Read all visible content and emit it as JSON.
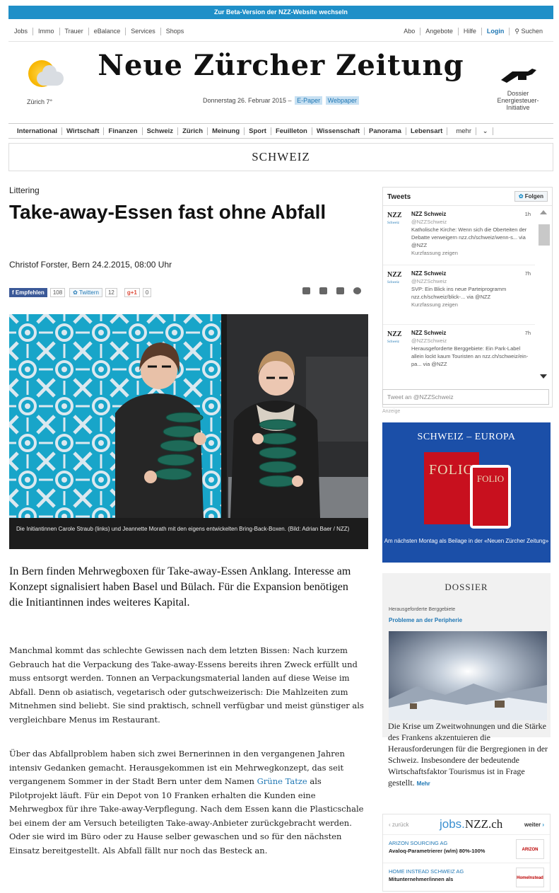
{
  "beta_banner": "Zur Beta-Version der NZZ-Website wechseln",
  "top_nav": {
    "left": [
      "Jobs",
      "Immo",
      "Trauer",
      "eBalance",
      "Services",
      "Shops"
    ],
    "right": [
      "Abo",
      "Angebote",
      "Hilfe",
      "Login",
      "Suchen"
    ]
  },
  "masthead": {
    "weather": "Zürich 7°",
    "logo": "Neue Zürcher Zeitung",
    "date": "Donnerstag 26. Februar 2015 –",
    "epaper": "E-Paper",
    "webpaper": "Webpaper",
    "dossier": "Dossier Energiesteuer-Initiative"
  },
  "section_nav": [
    "International",
    "Wirtschaft",
    "Finanzen",
    "Schweiz",
    "Zürich",
    "Meinung",
    "Sport",
    "Feuilleton",
    "Wissenschaft",
    "Panorama",
    "Lebensart",
    "mehr"
  ],
  "section_title": "SCHWEIZ",
  "article": {
    "kicker": "Littering",
    "headline": "Take-away-Essen fast ohne Abfall",
    "byline": "Christof Forster, Bern   24.2.2015, 08:00 Uhr",
    "social": {
      "fb_label": "Empfehlen",
      "fb_count": "108",
      "tw_label": "Twittern",
      "tw_count": "12",
      "gp_label": "g+1",
      "gp_count": "0"
    },
    "caption": "Die Initiantinnen Carole Straub (links) und Jeannette Morath mit den eigens entwickelten Bring-Back-Boxen.  (Bild: Adrian Baer / NZZ)",
    "lead": "In Bern finden Mehrwegboxen für Take-away-Essen Anklang. Interesse am Konzept signalisiert haben Basel und Bülach. Für die Expansion benötigen die Initiantinnen indes weiteres Kapital.",
    "p1": "Manchmal kommt das schlechte Gewissen nach dem letzten Bissen: Nach kurzem Gebrauch hat die Verpackung des Take-away-Essens bereits ihren Zweck erfüllt und muss entsorgt werden. Tonnen an Verpackungsmaterial landen auf diese Weise im Abfall. Denn ob asiatisch, vegetarisch oder gutschweizerisch: Die Mahlzeiten zum Mitnehmen sind beliebt. Sie sind praktisch, schnell verfügbar und meist günstiger als vergleichbare Menus im Restaurant.",
    "p2_before": "Über das Abfallproblem haben sich zwei Bernerinnen in den vergangenen Jahren intensiv Gedanken gemacht. Herausgekommen ist ein Mehrwegkonzept, das seit vergangenem Sommer in der Stadt Bern unter dem Namen ",
    "p2_link": "Grüne Tatze",
    "p2_after": " als Pilotprojekt läuft. Für ein Depot von 10 Franken erhalten die Kunden eine Mehrwegbox für ihre Take-away-Verpflegung. Nach dem Essen kann die Plasticschale bei einem der am Versuch beteiligten Take-away-Anbieter zurückgebracht werden. Oder sie wird im Büro oder zu Hause selber gewaschen und so für den nächsten Einsatz bereitgestellt. Als Abfall fällt nur noch das Besteck an."
  },
  "tweets": {
    "title": "Tweets",
    "follow": "Folgen",
    "items": [
      {
        "name": "NZZ Schweiz",
        "handle": "@NZZSchweiz",
        "time": "1h",
        "text": "Katholische Kirche: Wenn sich die Oberteiten der Debatte verweigern nzz.ch/schweiz/wenn-s... via @NZZ",
        "expand": "Kurzfassung zeigen"
      },
      {
        "name": "NZZ Schweiz",
        "handle": "@NZZSchweiz",
        "time": "7h",
        "text": "SVP: Ein Blick ins neue Parteiprogramm nzz.ch/schweiz/blick-... via @NZZ",
        "expand": "Kurzfassung zeigen"
      },
      {
        "name": "NZZ Schweiz",
        "handle": "@NZZSchweiz",
        "time": "7h",
        "text": "Herausgeforderte Berggebiete: Ein Park-Label allein lockt kaum Touristen an nzz.ch/schweiz/ein-pa... via @NZZ",
        "expand": ""
      }
    ],
    "input_placeholder": "Tweet an @NZZSchweiz"
  },
  "ad": {
    "label": "Anzeige",
    "title": "SCHWEIZ – EUROPA",
    "mag": "FOLIO",
    "text": "Am nächsten Montag als Beilage in der «Neuen Zürcher Zeitung»"
  },
  "dossier": {
    "title": "DOSSIER",
    "kicker": "Herausgeforderte Berggebiete",
    "link": "Probleme an der Peripherie",
    "text": "Die Krise um Zweitwohnungen und die Stärke des Frankens akzentuieren die Herausforderungen für die Bergregionen in der Schweiz. Insbesondere der bedeutende Wirtschaftsfaktor Tourismus ist in Frage gestellt.",
    "more": "Mehr"
  },
  "jobs": {
    "back": "zurück",
    "brand_prefix": "jobs.",
    "brand_suffix": "NZZ.ch",
    "next": "weiter",
    "items": [
      {
        "company": "ARIZON SOURCING AG",
        "title": "Avaloq-Parametrierer (w/m) 80%-100%",
        "logo": "ARIZON"
      },
      {
        "company": "HOME INSTEAD SCHWEIZ AG",
        "title": "Mitunternehmer/innen als",
        "logo": "HomeInstead"
      }
    ]
  },
  "colors": {
    "brand_blue": "#1f8fc8",
    "ad_blue": "#1b4fa8",
    "link": "#1f77b4"
  }
}
